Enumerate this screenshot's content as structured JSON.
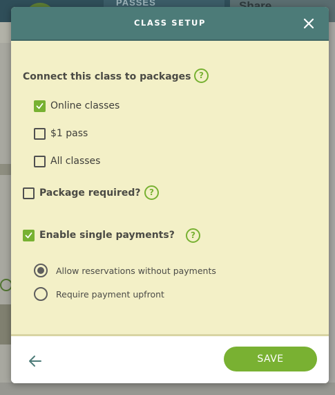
{
  "background": {
    "passes_label": "PASSES",
    "share_label": "Share"
  },
  "modal": {
    "title": "CLASS SETUP",
    "packages_label": "Connect this class to packages",
    "packages": [
      {
        "label": "Online classes",
        "checked": true
      },
      {
        "label": "$1 pass",
        "checked": false
      },
      {
        "label": "All classes",
        "checked": false
      }
    ],
    "package_required": {
      "label": "Package required?",
      "checked": false
    },
    "single_payments": {
      "label": "Enable single payments?",
      "checked": true
    },
    "payment_options": [
      {
        "label": "Allow reservations without payments",
        "selected": true
      },
      {
        "label": "Require payment upfront",
        "selected": false
      }
    ],
    "help_glyph": "?",
    "save_label": "SAVE"
  },
  "colors": {
    "header": "#4c7b78",
    "body": "#f3f0c7",
    "accent_green": "#79b132",
    "save_text": "#ffffff"
  },
  "icons": {
    "close": "close-icon",
    "help": "help-icon",
    "back": "arrow-left-icon",
    "check": "checkmark-icon"
  }
}
